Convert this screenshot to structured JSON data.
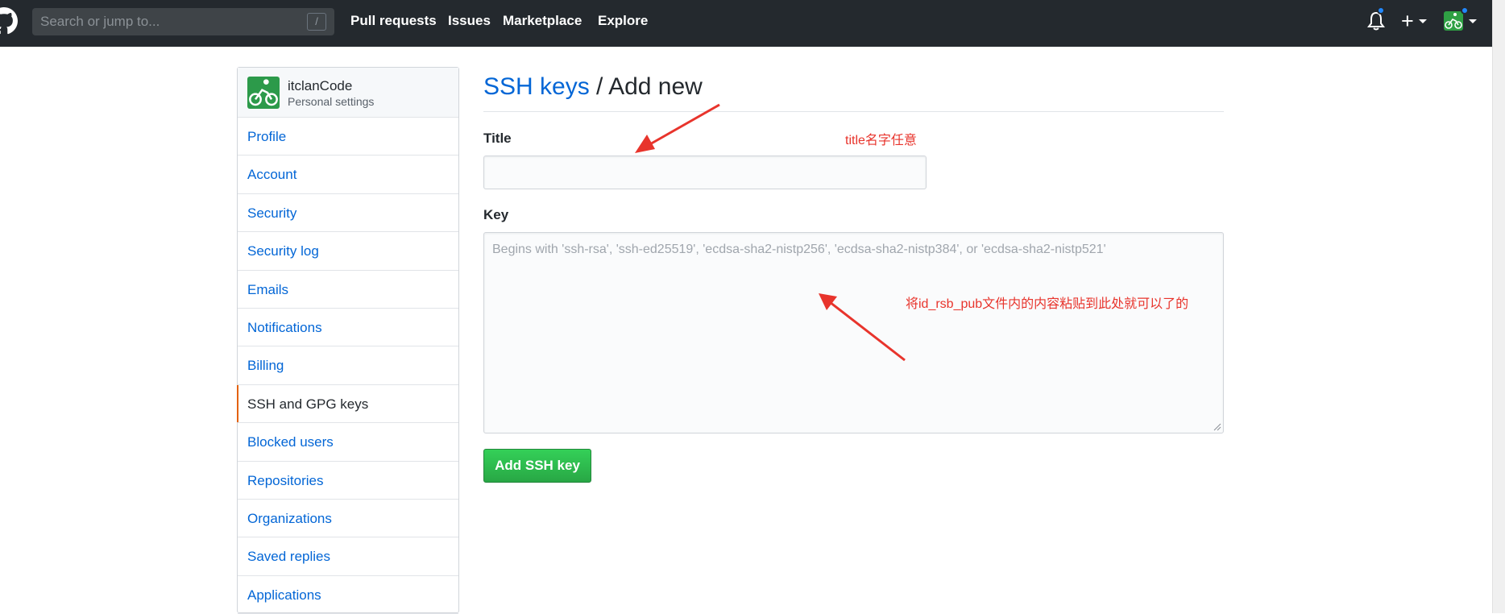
{
  "header": {
    "search_placeholder": "Search or jump to...",
    "search_shortcut": "/",
    "nav": [
      "Pull requests",
      "Issues",
      "Marketplace",
      "Explore"
    ],
    "plus_symbol": "+"
  },
  "sidebar": {
    "username": "itclanCode",
    "subtitle": "Personal settings",
    "items": [
      {
        "label": "Profile",
        "selected": false
      },
      {
        "label": "Account",
        "selected": false
      },
      {
        "label": "Security",
        "selected": false
      },
      {
        "label": "Security log",
        "selected": false
      },
      {
        "label": "Emails",
        "selected": false
      },
      {
        "label": "Notifications",
        "selected": false
      },
      {
        "label": "Billing",
        "selected": false
      },
      {
        "label": "SSH and GPG keys",
        "selected": true
      },
      {
        "label": "Blocked users",
        "selected": false
      },
      {
        "label": "Repositories",
        "selected": false
      },
      {
        "label": "Organizations",
        "selected": false
      },
      {
        "label": "Saved replies",
        "selected": false
      },
      {
        "label": "Applications",
        "selected": false
      }
    ]
  },
  "main": {
    "breadcrumb_link": "SSH keys",
    "breadcrumb_separator": " / ",
    "breadcrumb_current": "Add new",
    "title_label": "Title",
    "title_value": "",
    "key_label": "Key",
    "key_placeholder": "Begins with 'ssh-rsa', 'ssh-ed25519', 'ecdsa-sha2-nistp256', 'ecdsa-sha2-nistp384', or 'ecdsa-sha2-nistp521'",
    "submit_label": "Add SSH key"
  },
  "annotations": {
    "title_note": "title名字任意",
    "key_note": "将id_rsb_pub文件内的内容粘贴到此处就可以了的"
  },
  "colors": {
    "header_bg": "#24292e",
    "link": "#0366d6",
    "selected_accent": "#e36209",
    "button_green": "#28a745",
    "annotation_red": "#e8342c"
  },
  "icons": [
    "github-logo-icon",
    "bell-icon",
    "plus-icon",
    "caret-down-icon",
    "avatar"
  ]
}
